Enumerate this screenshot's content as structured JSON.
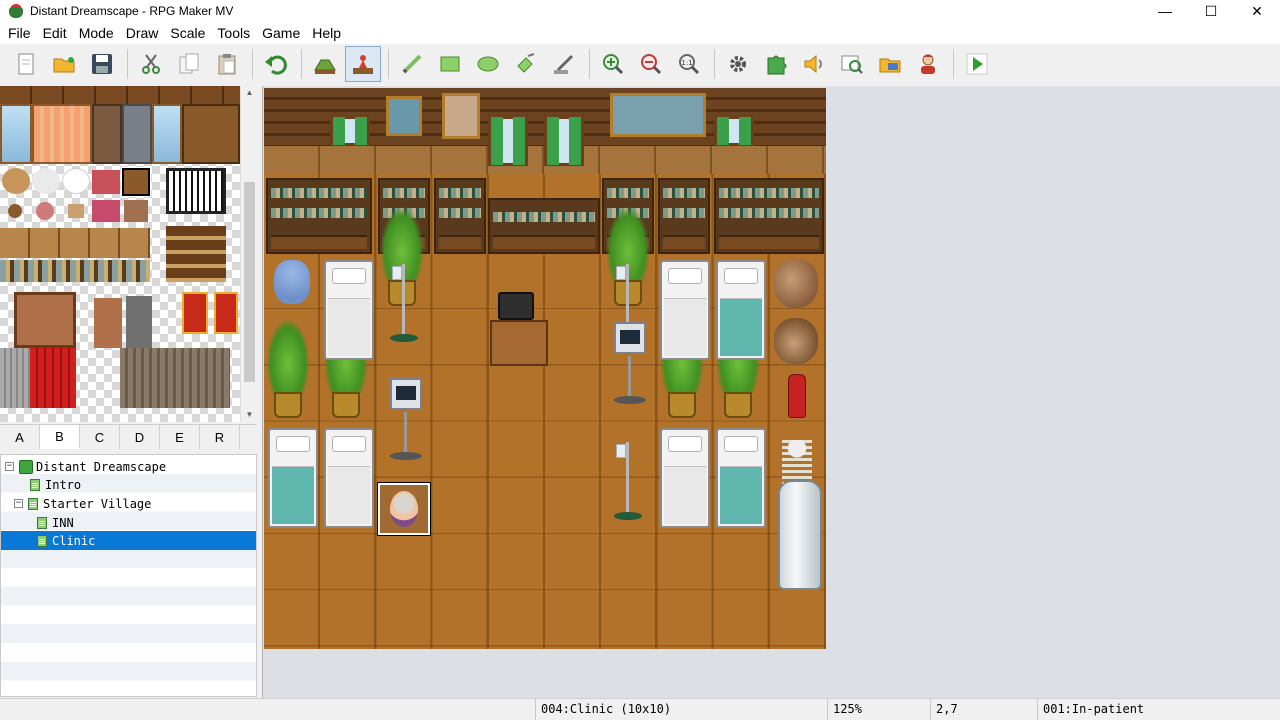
{
  "window": {
    "title": "Distant Dreamscape - RPG Maker MV",
    "minimize": "—",
    "maximize": "☐",
    "close": "✕"
  },
  "menu": [
    "File",
    "Edit",
    "Mode",
    "Draw",
    "Scale",
    "Tools",
    "Game",
    "Help"
  ],
  "toolbar": {
    "icons": [
      "new-project-icon",
      "open-project-icon",
      "save-project-icon",
      "cut-icon",
      "copy-icon",
      "paste-icon",
      "undo-icon",
      "map-mode-icon",
      "event-mode-icon",
      "pencil-icon",
      "rectangle-icon",
      "ellipse-icon",
      "fill-icon",
      "shadow-pen-icon",
      "zoom-in-icon",
      "zoom-out-icon",
      "actual-size-icon",
      "database-icon",
      "plugin-manager-icon",
      "sound-test-icon",
      "event-searcher-icon",
      "resource-manager-icon",
      "character-generator-icon",
      "playtest-icon"
    ]
  },
  "tileset": {
    "tabs": [
      "A",
      "B",
      "C",
      "D",
      "E",
      "R"
    ],
    "selected_tab": "B"
  },
  "tree": {
    "project": "Distant Dreamscape",
    "items": [
      {
        "label": "Intro"
      },
      {
        "label": "Starter Village"
      },
      {
        "label": "INN"
      },
      {
        "label": "Clinic"
      }
    ],
    "selected": "Clinic"
  },
  "status": {
    "map": "004:Clinic (10x10)",
    "zoom": "125%",
    "coords": "2,7",
    "event": "001:In-patient"
  }
}
